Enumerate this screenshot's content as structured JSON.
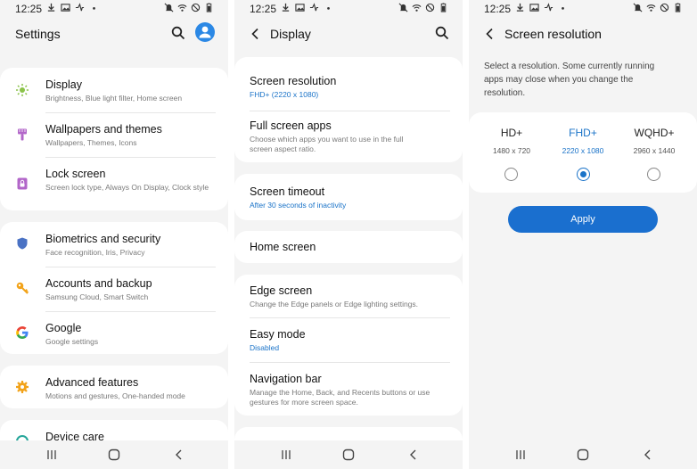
{
  "status": {
    "time": "12:25"
  },
  "colors": {
    "accent": "#1a73c8",
    "apply_button": "#1a6fcf",
    "avatar": "#2b88e5",
    "display_icon": "#8bc34a",
    "wallpaper_icon": "#b266c9",
    "lock_icon": "#b266c9",
    "biometrics_icon": "#4a72c4",
    "accounts_icon": "#f2a31a",
    "advanced_icon": "#f2a31a"
  },
  "settings": {
    "title": "Settings",
    "items": [
      {
        "title": "Display",
        "subtitle": "Brightness, Blue light filter, Home screen",
        "icon": "sun-icon"
      },
      {
        "title": "Wallpapers and themes",
        "subtitle": "Wallpapers, Themes, Icons",
        "icon": "brush-icon"
      },
      {
        "title": "Lock screen",
        "subtitle": "Screen lock type, Always On Display, Clock style",
        "icon": "lock-icon"
      },
      {
        "title": "Biometrics and security",
        "subtitle": "Face recognition, Iris, Privacy",
        "icon": "shield-icon"
      },
      {
        "title": "Accounts and backup",
        "subtitle": "Samsung Cloud, Smart Switch",
        "icon": "key-icon"
      },
      {
        "title": "Google",
        "subtitle": "Google settings",
        "icon": "google-icon"
      },
      {
        "title": "Advanced features",
        "subtitle": "Motions and gestures, One-handed mode",
        "icon": "gear-icon"
      },
      {
        "title": "Device care",
        "subtitle": "",
        "icon": "device-care-icon"
      }
    ]
  },
  "display": {
    "title": "Display",
    "items": [
      {
        "title": "Screen resolution",
        "subtitle": "FHD+ (2220 x 1080)"
      },
      {
        "title": "Full screen apps",
        "subtitle": "Choose which apps you want to use in the full screen aspect ratio."
      },
      {
        "title": "Screen timeout",
        "subtitle": "After 30 seconds of inactivity"
      },
      {
        "title": "Home screen",
        "subtitle": ""
      },
      {
        "title": "Edge screen",
        "subtitle": "Change the Edge panels or Edge lighting settings."
      },
      {
        "title": "Easy mode",
        "subtitle": "Disabled"
      },
      {
        "title": "Navigation bar",
        "subtitle": "Manage the Home, Back, and Recents buttons or use gestures for more screen space."
      }
    ]
  },
  "resolution": {
    "title": "Screen resolution",
    "description": "Select a resolution. Some currently running apps may close when you change the resolution.",
    "options": [
      {
        "name": "HD+",
        "dims": "1480 x 720"
      },
      {
        "name": "FHD+",
        "dims": "2220 x 1080"
      },
      {
        "name": "WQHD+",
        "dims": "2960 x 1440"
      }
    ],
    "selected": "FHD+",
    "apply_label": "Apply"
  }
}
